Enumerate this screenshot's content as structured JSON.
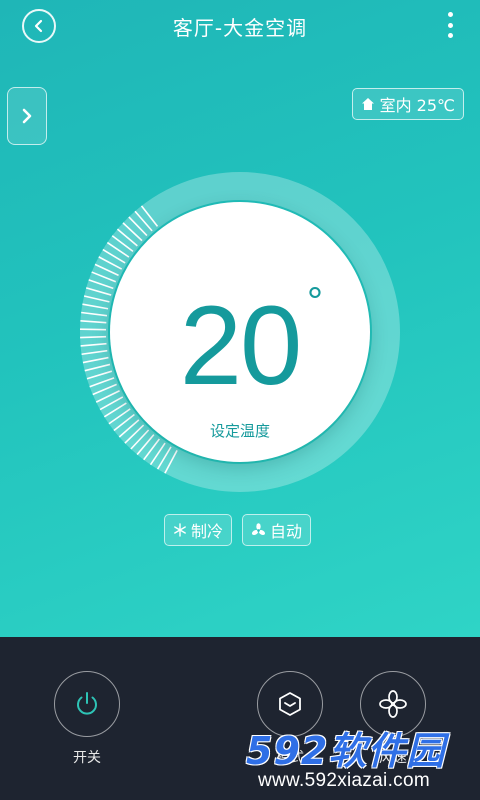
{
  "header": {
    "title": "客厅-大金空调"
  },
  "indoor": {
    "label": "室内 25℃"
  },
  "dial": {
    "temperature": "20",
    "unit": "°",
    "label": "设定温度"
  },
  "status": {
    "mode": "制冷",
    "fan": "自动"
  },
  "controls": {
    "power_label": "开关",
    "mode_label": "模式",
    "fan_label": "风速"
  },
  "watermark": {
    "logo": "592软件园",
    "url": "www.592xiazai.com"
  },
  "colors": {
    "accent": "#159a9c",
    "bottom_bar": "#1e2430",
    "watermark_blue": "#2f6fe6"
  }
}
